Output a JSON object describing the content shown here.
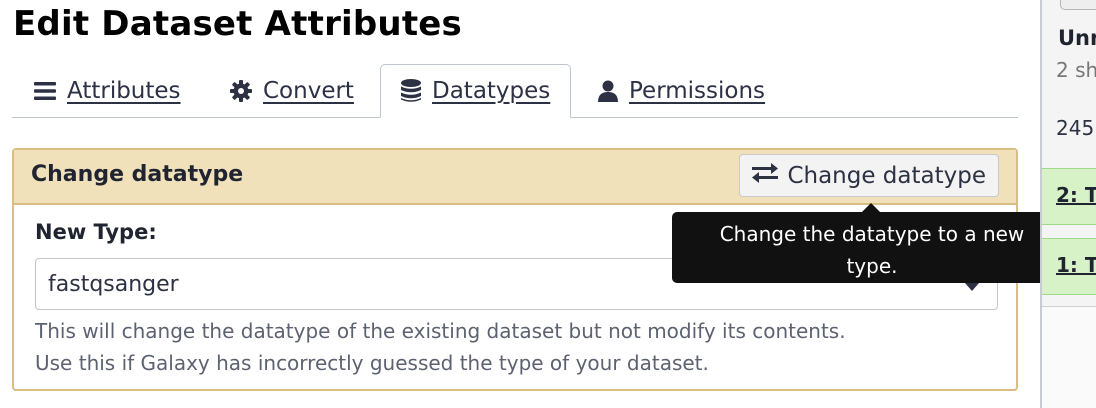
{
  "page": {
    "title": "Edit Dataset Attributes"
  },
  "tabs": [
    {
      "label": "Attributes",
      "icon": "bars-icon",
      "active": false
    },
    {
      "label": "Convert",
      "icon": "gear-icon",
      "active": false
    },
    {
      "label": "Datatypes",
      "icon": "database-icon",
      "active": true
    },
    {
      "label": "Permissions",
      "icon": "user-icon",
      "active": false
    }
  ],
  "card": {
    "title": "Change datatype",
    "button_label": "Change datatype",
    "button_icon": "exchange-icon",
    "field_label": "New Type:",
    "selected_type": "fastqsanger",
    "help_line1": "This will change the datatype of the existing dataset but not modify its contents.",
    "help_line2": "Use this if Galaxy has incorrectly guessed the type of your dataset."
  },
  "tooltip": {
    "text": "Change the datatype to a new type."
  },
  "history": {
    "name": "Unn",
    "subtitle": "2 sh",
    "size": "245",
    "items": [
      "2: T",
      "1: T"
    ]
  },
  "colors": {
    "card_header": "#f0e1bb",
    "card_border": "#d9bd82",
    "history_ok": "#d8f2c7",
    "tooltip_bg": "#111111"
  }
}
